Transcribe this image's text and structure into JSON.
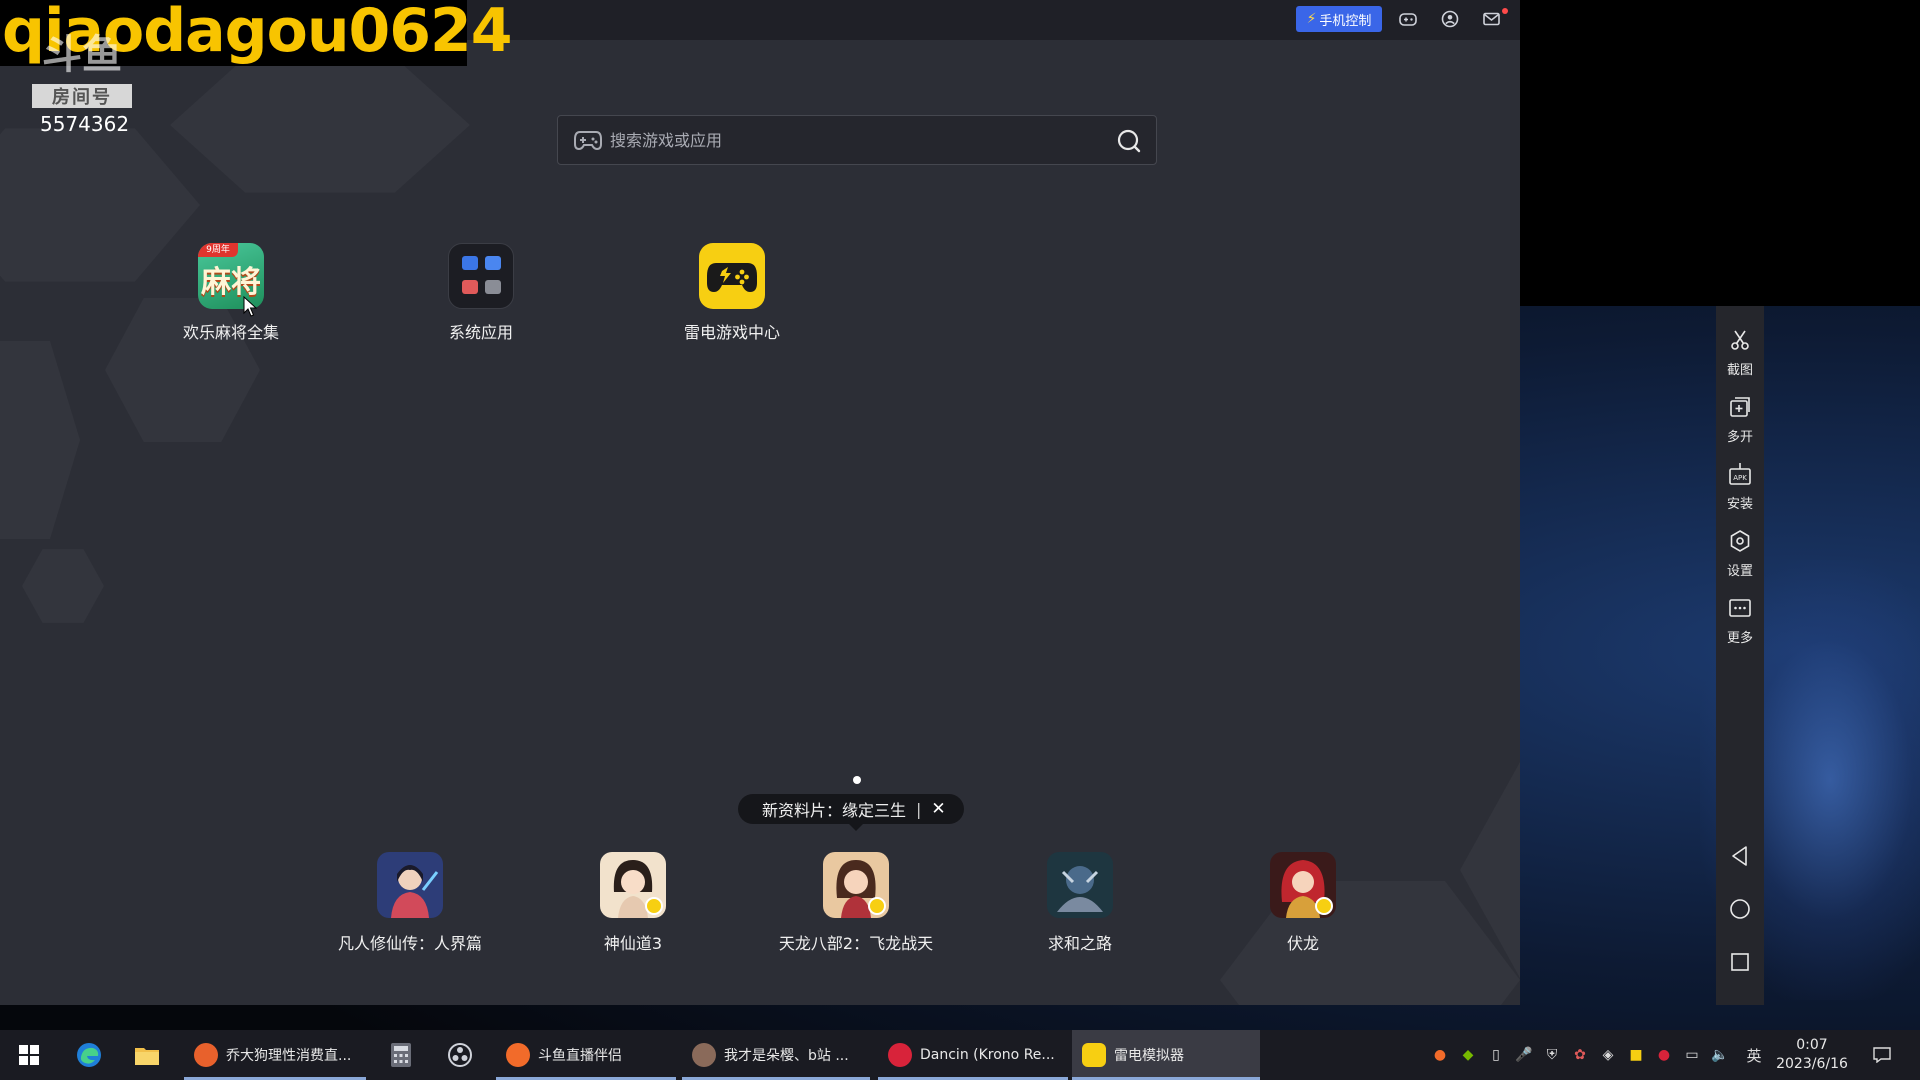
{
  "overlay": {
    "streamer_name": "qiaodagou0624",
    "room_tag": "房间号",
    "room_number": "5574362",
    "douyu_logo": "斗鱼"
  },
  "titlebar": {
    "phone_control_label": "手机控制",
    "icons": [
      "lightning-icon",
      "gamepad-icon",
      "user-icon",
      "mail-icon"
    ]
  },
  "search": {
    "placeholder": "搜索游戏或应用"
  },
  "apps": [
    {
      "label": "欢乐麻将全集",
      "badge": "9周年",
      "glyph": "麻将"
    },
    {
      "label": "系统应用"
    },
    {
      "label": "雷电游戏中心"
    }
  ],
  "promo": {
    "text": "新资料片：缘定三生",
    "separator": "|",
    "close": "✕"
  },
  "games": [
    {
      "label": "凡人修仙传：人界篇",
      "color": "#3a4f8c"
    },
    {
      "label": "神仙道3",
      "color": "#e8c7a8"
    },
    {
      "label": "天龙八部2：飞龙战天",
      "color": "#c77a5a"
    },
    {
      "label": "求和之路",
      "color": "#3a5a6a"
    },
    {
      "label": "伏龙",
      "color": "#b0323a"
    }
  ],
  "sidebar": {
    "items": [
      {
        "label": "截图",
        "icon": "scissors-icon"
      },
      {
        "label": "多开",
        "icon": "multi-window-icon"
      },
      {
        "label": "安装",
        "icon": "apk-install-icon"
      },
      {
        "label": "设置",
        "icon": "gear-icon"
      },
      {
        "label": "更多",
        "icon": "more-icon"
      }
    ],
    "nav": [
      "back-icon",
      "home-icon",
      "recents-icon"
    ]
  },
  "taskbar": {
    "apps": [
      {
        "label": "乔大狗理性消费直...",
        "color": "#e8612c"
      },
      {
        "label": "斗鱼直播伴侣",
        "color": "#f26b2a"
      },
      {
        "label": "我才是朵樱、b站 ...",
        "color": "#8a6a5a"
      },
      {
        "label": "Dancin (Krono Re...",
        "color": "#d8233a"
      },
      {
        "label": "雷电模拟器",
        "color": "#f7cf12"
      }
    ],
    "ime": "英",
    "time": "0:07",
    "date": "2023/6/16"
  }
}
